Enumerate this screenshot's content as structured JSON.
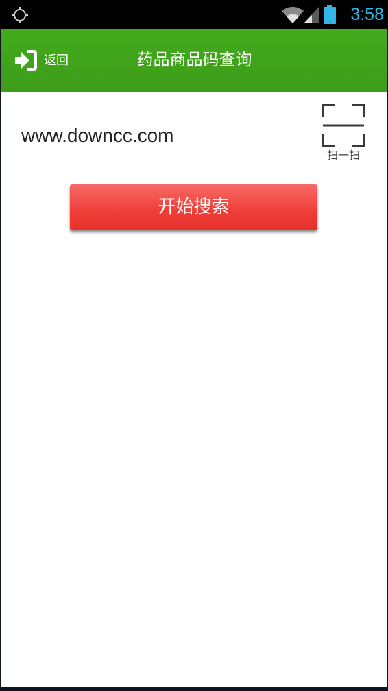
{
  "status_bar": {
    "time": "3:58",
    "icons": [
      "gps-icon",
      "wifi-icon",
      "signal-icon",
      "battery-icon"
    ],
    "time_color": "#33b5e5"
  },
  "header": {
    "back_label": "返回",
    "back_icon": "sign-in-arrow-icon",
    "title": "药品商品码查询",
    "background_color": "#3fa11a"
  },
  "search": {
    "input_value": "www.downcc.com",
    "scan_label": "扫一扫",
    "scan_icon": "scan-frame-icon",
    "button_label": "开始搜索",
    "button_color": "#ee3d37"
  }
}
